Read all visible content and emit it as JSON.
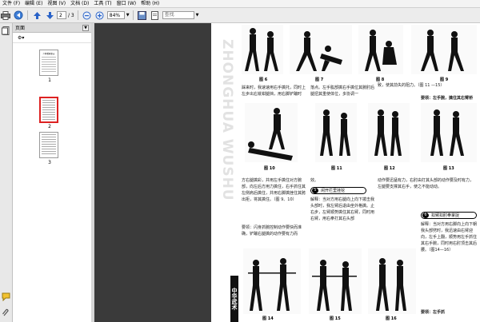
{
  "menu": [
    "文件 (F)",
    "编辑 (E)",
    "视图 (V)",
    "文档 (D)",
    "工具 (T)",
    "窗口 (W)",
    "帮助 (H)"
  ],
  "toolbar": {
    "page_current": "2",
    "page_total": "/ 3",
    "zoom": "84%",
    "search_placeholder": "查找"
  },
  "panel": {
    "title": "页面",
    "thumbs": [
      {
        "num": "1",
        "label": "少林看家拳五"
      },
      {
        "num": "2",
        "label": ""
      },
      {
        "num": "3",
        "label": ""
      }
    ]
  },
  "doc": {
    "vertical_title": "ZHONGHUA WUSHU",
    "seal": "中华武术",
    "figures": {
      "f6": "图 6",
      "f7": "图 7",
      "f8": "图 8",
      "f9": "图 9",
      "f10": "图 10",
      "f11": "图 11",
      "f12": "图 12",
      "f13": "图 13",
      "f14": "图 14",
      "f15": "图 15",
      "f16": "图 16"
    },
    "text": {
      "t1": "踩来时，我速速用右手擒托，同时上左步出右铣钳腿挡，用右脚铲踹时",
      "t2": "落点。左手肱部擒右手擒位其腕肘后腿扭其重使体位，多协调一",
      "t3": "致，使其前失的阻力。（图 11 —15）",
      "t4": "要领：左手腕，擒住其右臂桥",
      "t5": "方右腿擒彩，并用左手擒住对方腕部，向左后方用力擒住，右手抓住其左侧肩后擒住，并用右脚擒挫住其胯出拒，将其擒住。（图 9、10）",
      "t6": "要领：闪身抓腕控制动作要快而准确，铲踹右腿擒的动作要有力而",
      "t7": "效。",
      "t8": "解释：当对方用右腿向上向下拨击我头部时，我左臂后退由坐外格擒。止右步，左臂顺势擒住其右臂，同时用右臂，用右拳打其右头部",
      "t9": "动作要迅猛有力，右肘由打其头部的动作要及时有力，左腿要支撑其右手，使之不能动动。",
      "t10": "解释：当对方用右脚向上向下朝我头部劈时，我迅速由右臂迎向，左手上翻，顺势用左手抓住其右手腕，同时用右肘顶击其后腰。（图14—16）",
      "t11": "要领：左手抓",
      "b5": "闲开拦里挂挖",
      "b5n": "5",
      "b6": "扣臂扣肘拳掌捉",
      "b6n": "6"
    }
  },
  "colors": {
    "accent_blue": "#2a63c8",
    "selection_red": "#d22222",
    "doc_bg": "#3a3a3a"
  },
  "icons": [
    "print-icon",
    "share-icon",
    "up-arrow-icon",
    "down-arrow-icon",
    "zoom-out-icon",
    "zoom-in-icon",
    "save-icon",
    "fit-page-icon",
    "pages-panel-icon",
    "comment-icon",
    "attachment-icon"
  ]
}
